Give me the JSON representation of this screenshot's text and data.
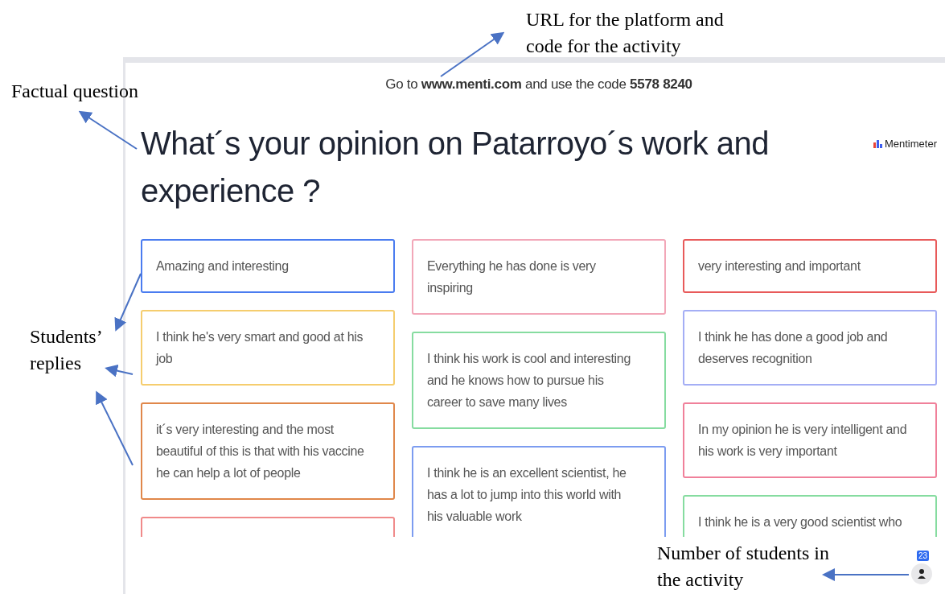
{
  "annotations": [
    {
      "text": "URL for the platform and code for the activity",
      "kind": "url"
    },
    {
      "text": "Factual question",
      "kind": "question"
    },
    {
      "text": "Students’ replies",
      "kind": "replies"
    },
    {
      "text": "Number of students in the activity",
      "kind": "count"
    }
  ],
  "slide": {
    "join_line": "Go to **www.menti.com** and use the code **5578 8240**",
    "brand": "Mentimeter",
    "title": "What´s  your opinion on Patarroyo´s work and experience ?",
    "columns": [
      [
        {
          "text": "Amazing and interesting",
          "color": "#4a7cf0"
        },
        {
          "text": "I think he's very smart and good at his job",
          "color": "#f5cd6e"
        },
        {
          "text": "it´s very interesting and the most beautiful of this is that with his vaccine he can help a lot of people",
          "color": "#e0874a"
        },
        {
          "color": "#f08a8a"
        }
      ],
      [
        {
          "text": "Everything he has done is very inspiring",
          "color": "#f2a7b8"
        },
        {
          "text": "I think his work is cool and interesting and he knows how to pursue his career to save many lives",
          "color": "#86dca0"
        },
        {
          "text": "I think he is an excellent scientist, he has a lot to jump into this world with his valuable work",
          "color": "#7c9cf0"
        }
      ],
      [
        {
          "text": "very interesting and important",
          "color": "#e85a5a"
        },
        {
          "text": "I think he has done a good job and deserves recognition",
          "color": "#a4aef5"
        },
        {
          "text": "In my opinion he is very intelligent and his work is very important",
          "color": "#f0809a"
        },
        {
          "text": "I think he is a very good scientist who",
          "color": "#86dca0"
        }
      ]
    ],
    "participants": "23"
  }
}
